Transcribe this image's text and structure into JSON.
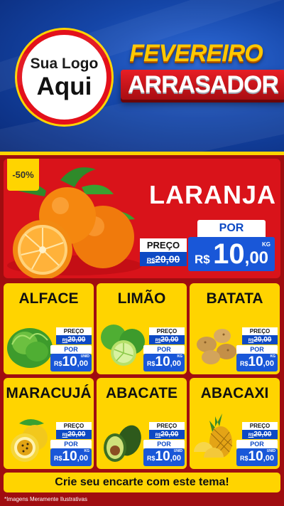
{
  "logo": {
    "line1": "Sua Logo",
    "line2": "Aqui"
  },
  "title": {
    "line1": "FEVEREIRO",
    "line2": "ARRASADOR"
  },
  "hero": {
    "discount": "-50%",
    "name": "LARANJA",
    "old_label": "PREÇO",
    "old_prefix": "R$",
    "old_price": "20,00",
    "new_label": "POR",
    "currency": "R$",
    "price_int": "10",
    "price_dec": ",00",
    "unit": "KG"
  },
  "products": [
    {
      "name": "ALFACE",
      "old_label": "PREÇO",
      "old_prefix": "R$",
      "old_price": "20,00",
      "new_label": "POR",
      "currency": "R$",
      "price_int": "10",
      "price_dec": ",00",
      "unit": "UNID"
    },
    {
      "name": "LIMÃO",
      "old_label": "PREÇO",
      "old_prefix": "R$",
      "old_price": "20,00",
      "new_label": "POR",
      "currency": "R$",
      "price_int": "10",
      "price_dec": ",00",
      "unit": "KG"
    },
    {
      "name": "BATATA",
      "old_label": "PREÇO",
      "old_prefix": "R$",
      "old_price": "20,00",
      "new_label": "POR",
      "currency": "R$",
      "price_int": "10",
      "price_dec": ",00",
      "unit": "KG"
    },
    {
      "name": "MARACUJÁ",
      "old_label": "PREÇO",
      "old_prefix": "R$",
      "old_price": "20,00",
      "new_label": "POR",
      "currency": "R$",
      "price_int": "10",
      "price_dec": ",00",
      "unit": "KG"
    },
    {
      "name": "ABACATE",
      "old_label": "PREÇO",
      "old_prefix": "R$",
      "old_price": "20,00",
      "new_label": "POR",
      "currency": "R$",
      "price_int": "10",
      "price_dec": ",00",
      "unit": "UNID"
    },
    {
      "name": "ABACAXI",
      "old_label": "PREÇO",
      "old_prefix": "R$",
      "old_price": "20,00",
      "new_label": "POR",
      "currency": "R$",
      "price_int": "10",
      "price_dec": ",00",
      "unit": "UNID"
    }
  ],
  "footer": {
    "cta": "Crie seu encarte com este tema!",
    "note": "*Imagens Meramente Ilustrativas"
  },
  "colors": {
    "background_blue": "#1546a8",
    "panel_red": "#a00d10",
    "hero_red": "#d9131a",
    "card_yellow": "#ffd400",
    "price_blue": "#1957d8"
  }
}
